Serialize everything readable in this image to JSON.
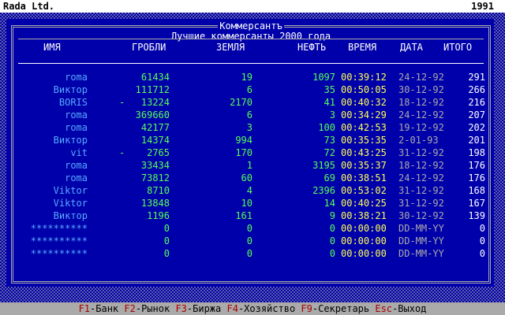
{
  "topbar": {
    "company": "Rada Ltd.",
    "year": "1991"
  },
  "window": {
    "title": "Коммерсантъ",
    "subtitle": "Лучшие коммерсанты 2000 года",
    "headers": [
      "ИМЯ",
      "ГРОБЛИ",
      "ЗЕМЛЯ",
      "НЕФТЬ",
      "ВРЕМЯ",
      "ДАТА",
      "ИТОГО"
    ]
  },
  "rows": [
    {
      "name": "roma",
      "neg": "",
      "grob": "61434",
      "zem": "19",
      "neft": "1097",
      "time": "00:39:12",
      "date": "24-12-92",
      "total": "291"
    },
    {
      "name": "Виктор",
      "neg": "",
      "grob": "111712",
      "zem": "6",
      "neft": "35",
      "time": "00:50:05",
      "date": "30-12-92",
      "total": "266"
    },
    {
      "name": "BORIS",
      "neg": "-",
      "grob": "13224",
      "zem": "2170",
      "neft": "41",
      "time": "00:40:32",
      "date": "18-12-92",
      "total": "216"
    },
    {
      "name": "roma",
      "neg": "",
      "grob": "369660",
      "zem": "6",
      "neft": "3",
      "time": "00:34:29",
      "date": "24-12-92",
      "total": "207"
    },
    {
      "name": "roma",
      "neg": "",
      "grob": "42177",
      "zem": "3",
      "neft": "100",
      "time": "00:42:53",
      "date": "19-12-92",
      "total": "202"
    },
    {
      "name": "Виктор",
      "neg": "",
      "grob": "14374",
      "zem": "994",
      "neft": "73",
      "time": "00:35:35",
      "date": "2-01-93",
      "total": "201"
    },
    {
      "name": "vit",
      "neg": "-",
      "grob": "2765",
      "zem": "170",
      "neft": "72",
      "time": "00:43:25",
      "date": "31-12-92",
      "total": "198"
    },
    {
      "name": "roma",
      "neg": "",
      "grob": "33434",
      "zem": "1",
      "neft": "3195",
      "time": "00:35:37",
      "date": "18-12-92",
      "total": "176"
    },
    {
      "name": "roma",
      "neg": "",
      "grob": "73812",
      "zem": "60",
      "neft": "69",
      "time": "00:38:51",
      "date": "24-12-92",
      "total": "176"
    },
    {
      "name": "Viktor",
      "neg": "",
      "grob": "8710",
      "zem": "4",
      "neft": "2396",
      "time": "00:53:02",
      "date": "31-12-92",
      "total": "168"
    },
    {
      "name": "Viktor",
      "neg": "",
      "grob": "13848",
      "zem": "10",
      "neft": "14",
      "time": "00:40:25",
      "date": "31-12-92",
      "total": "167"
    },
    {
      "name": "Виктор",
      "neg": "",
      "grob": "1196",
      "zem": "161",
      "neft": "9",
      "time": "00:38:21",
      "date": "30-12-92",
      "total": "139"
    },
    {
      "name": "**********",
      "neg": "",
      "grob": "0",
      "zem": "0",
      "neft": "0",
      "time": "00:00:00",
      "date": "DD-MM-YY",
      "total": "0"
    },
    {
      "name": "**********",
      "neg": "",
      "grob": "0",
      "zem": "0",
      "neft": "0",
      "time": "00:00:00",
      "date": "DD-MM-YY",
      "total": "0"
    },
    {
      "name": "**********",
      "neg": "",
      "grob": "0",
      "zem": "0",
      "neft": "0",
      "time": "00:00:00",
      "date": "DD-MM-YY",
      "total": "0"
    }
  ],
  "statusbar": {
    "items": [
      {
        "key": "F1",
        "label": "-Банк"
      },
      {
        "key": "F2",
        "label": "-Рынок"
      },
      {
        "key": "F3",
        "label": "-Биржа"
      },
      {
        "key": "F4",
        "label": "-Хозяйство"
      },
      {
        "key": "F9",
        "label": "-Секретарь"
      },
      {
        "key": "Esc",
        "label": "-Выход"
      }
    ]
  },
  "colors": {
    "background": "#0000aa",
    "name": "#55aaff",
    "number": "#55ff55",
    "time": "#ffff55",
    "date": "#aaaaaa",
    "key": "#aa0000"
  }
}
